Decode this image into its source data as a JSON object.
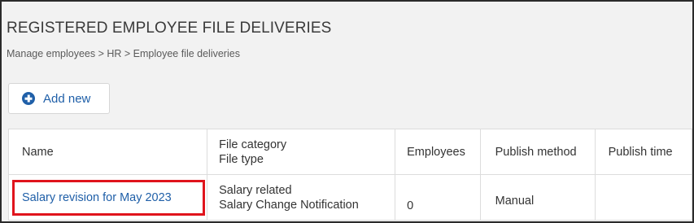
{
  "page": {
    "title": "REGISTERED EMPLOYEE FILE DELIVERIES",
    "breadcrumb": "Manage employees > HR > Employee file deliveries"
  },
  "toolbar": {
    "add_new_label": "Add new",
    "add_icon": "plus-circle-icon"
  },
  "table": {
    "headers": {
      "name": "Name",
      "file_category": "File category",
      "file_type": "File type",
      "employees": "Employees",
      "publish_method": "Publish method",
      "publish_time": "Publish time"
    },
    "rows": [
      {
        "name": "Salary revision for May 2023",
        "file_category": "Salary related",
        "file_type": "Salary Change Notification",
        "employees": "0",
        "publish_method": "Manual",
        "publish_time": ""
      }
    ]
  },
  "colors": {
    "accent": "#1f5fa8",
    "highlight": "#e0141c",
    "background": "#f2f2f2"
  }
}
